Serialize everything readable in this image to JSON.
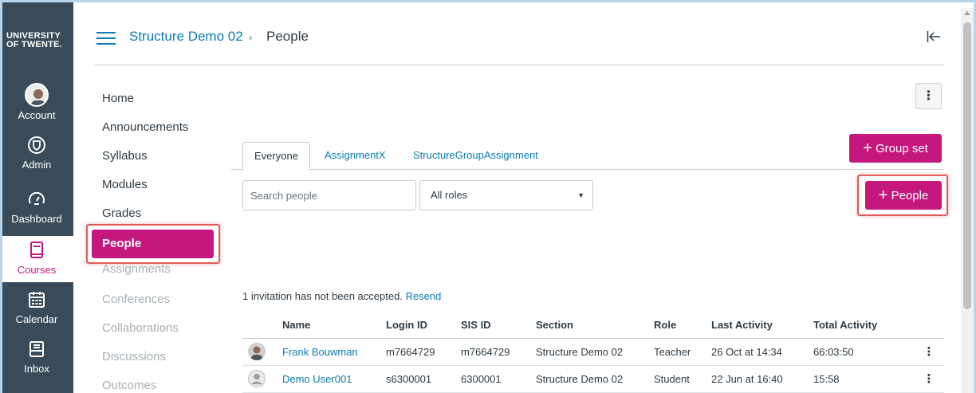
{
  "global_nav": {
    "logo_line1": "UNIVERSITY",
    "logo_line2": "OF TWENTE.",
    "items": [
      {
        "label": "Account",
        "icon": "avatar"
      },
      {
        "label": "Admin",
        "icon": "shield-icon"
      },
      {
        "label": "Dashboard",
        "icon": "speedometer-icon"
      },
      {
        "label": "Courses",
        "icon": "book-icon"
      },
      {
        "label": "Calendar",
        "icon": "calendar-icon"
      },
      {
        "label": "Inbox",
        "icon": "inbox-icon"
      }
    ]
  },
  "header": {
    "course": "Structure Demo 02",
    "separator": "›",
    "current": "People"
  },
  "course_nav": {
    "items": [
      {
        "label": "Home"
      },
      {
        "label": "Announcements"
      },
      {
        "label": "Syllabus"
      },
      {
        "label": "Modules"
      },
      {
        "label": "Grades"
      },
      {
        "label": "People"
      },
      {
        "label": "Assignments"
      },
      {
        "label": "Conferences"
      },
      {
        "label": "Collaborations"
      },
      {
        "label": "Discussions"
      },
      {
        "label": "Outcomes"
      }
    ]
  },
  "toolbar": {
    "kebab": "⋮",
    "group_set_label": "Group set",
    "add_people_label": "People",
    "plus": "+"
  },
  "tabs": [
    {
      "label": "Everyone"
    },
    {
      "label": "AssignmentX"
    },
    {
      "label": "StructureGroupAssignment"
    }
  ],
  "filters": {
    "search_placeholder": "Search people",
    "role_selected": "All roles"
  },
  "invitation": {
    "text": "1 invitation has not been accepted.",
    "link": "Resend"
  },
  "table": {
    "columns": [
      "Name",
      "Login ID",
      "SIS ID",
      "Section",
      "Role",
      "Last Activity",
      "Total Activity"
    ],
    "rows": [
      {
        "name": "Frank Bouwman",
        "login_id": "m7664729",
        "sis_id": "m7664729",
        "section": "Structure Demo 02",
        "role": "Teacher",
        "last_activity": "26 Oct at 14:34",
        "total_activity": "66:03:50"
      },
      {
        "name": "Demo User001",
        "login_id": "s6300001",
        "sis_id": "6300001",
        "section": "Structure Demo 02",
        "role": "Student",
        "last_activity": "22 Jun at 16:40",
        "total_activity": "15:58"
      }
    ]
  },
  "colors": {
    "nav_bg": "#394b58",
    "accent": "#c5187e",
    "link": "#0b7bb5",
    "highlight": "#e05a5a"
  }
}
